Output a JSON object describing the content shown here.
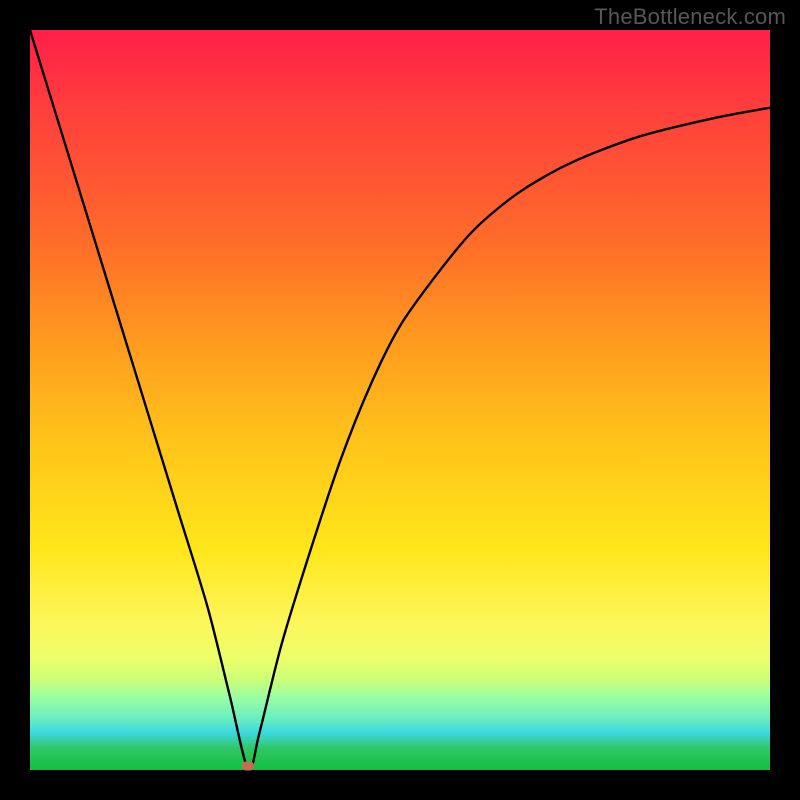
{
  "watermark": "TheBottleneck.com",
  "chart_data": {
    "type": "line",
    "title": "",
    "xlabel": "",
    "ylabel": "",
    "xlim": [
      0,
      100
    ],
    "ylim": [
      0,
      100
    ],
    "grid": false,
    "legend": false,
    "background_gradient": {
      "direction": "vertical",
      "stops": [
        {
          "pos": 0,
          "color": "#ff1f4a"
        },
        {
          "pos": 28,
          "color": "#ff6a2a"
        },
        {
          "pos": 55,
          "color": "#ffc21a"
        },
        {
          "pos": 80,
          "color": "#fdf65a"
        },
        {
          "pos": 90,
          "color": "#9dffa0"
        },
        {
          "pos": 100,
          "color": "#13bf3f"
        }
      ]
    },
    "series": [
      {
        "name": "bottleneck-curve",
        "color": "#000000",
        "x": [
          0,
          4,
          8,
          12,
          16,
          20,
          24,
          27,
          29.5,
          31,
          34,
          38,
          42,
          46,
          50,
          55,
          60,
          66,
          73,
          82,
          92,
          100
        ],
        "values": [
          100,
          87,
          74,
          61,
          48,
          35,
          22,
          10,
          0,
          5,
          17,
          30,
          42,
          52,
          60,
          67,
          73,
          78,
          82,
          85.5,
          88,
          89.5
        ]
      }
    ],
    "marker": {
      "name": "optimal-point",
      "x": 29.5,
      "y": 0.5,
      "color": "#c96a55"
    }
  }
}
